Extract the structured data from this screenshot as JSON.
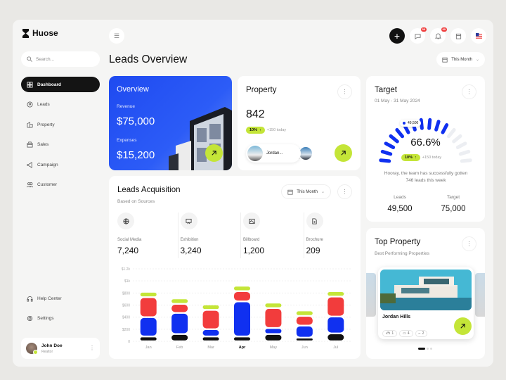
{
  "app": {
    "name": "Huose",
    "search_placeholder": "Search..."
  },
  "sidebar": {
    "items": [
      {
        "label": "Dashboard",
        "icon": "grid-icon",
        "active": true
      },
      {
        "label": "Leads",
        "icon": "leads-icon"
      },
      {
        "label": "Property",
        "icon": "building-icon"
      },
      {
        "label": "Sales",
        "icon": "sales-icon"
      },
      {
        "label": "Campaign",
        "icon": "megaphone-icon"
      },
      {
        "label": "Customer",
        "icon": "users-icon"
      }
    ],
    "bottom": [
      {
        "label": "Help Center",
        "icon": "headset-icon"
      },
      {
        "label": "Settings",
        "icon": "gear-icon"
      }
    ],
    "user": {
      "name": "John Doe",
      "role": "Realtor"
    }
  },
  "header": {
    "messages_badge": "99",
    "notifications_badge": "99",
    "title": "Leads Overview",
    "period": "This Month"
  },
  "overview": {
    "title": "Overview",
    "revenue_label": "Revenue",
    "revenue": "$75,000",
    "expenses_label": "Expenses",
    "expenses": "$15,200"
  },
  "property": {
    "title": "Property",
    "count": "842",
    "change": "10%",
    "today": "+150 today",
    "first_name": "Jordan..."
  },
  "target": {
    "title": "Target",
    "range": "01 May - 31 May 2024",
    "percent": "66.6%",
    "progress": 0.666,
    "marker": "49,500",
    "change": "10%",
    "today": "+150 today",
    "message": "Hooray, the team has successfully gotten 746 leads this week",
    "leads_label": "Leads",
    "leads": "49,500",
    "target_label": "Target",
    "target": "75,000"
  },
  "leads": {
    "title": "Leads Acquisition",
    "subtitle": "Based on Sources",
    "period": "This Month",
    "sources": [
      {
        "label": "Social Media",
        "value": "7,240",
        "icon": "globe-icon"
      },
      {
        "label": "Exhibition",
        "value": "3,240",
        "icon": "presentation-icon"
      },
      {
        "label": "Billboard",
        "value": "1,200",
        "icon": "image-icon"
      },
      {
        "label": "Brochure",
        "value": "209",
        "icon": "document-icon"
      }
    ]
  },
  "chart_data": {
    "type": "bar",
    "stacked": true,
    "categories": [
      "Jan",
      "Feb",
      "Mar",
      "Apr",
      "May",
      "Jun",
      "Jul"
    ],
    "highlight": "Apr",
    "yticks": [
      "0",
      "$200",
      "$400",
      "$600",
      "$800",
      "$1k",
      "$1.2k"
    ],
    "ylim": [
      0,
      1200
    ],
    "grid": true,
    "series": [
      {
        "name": "black",
        "color": "#111111",
        "values": [
          80,
          120,
          80,
          80,
          120,
          60,
          130
        ]
      },
      {
        "name": "blue",
        "color": "#1030f0",
        "values": [
          320,
          350,
          120,
          580,
          100,
          200,
          280
        ]
      },
      {
        "name": "red",
        "color": "#f23c3c",
        "values": [
          330,
          150,
          320,
          170,
          330,
          160,
          330
        ]
      },
      {
        "name": "green",
        "color": "#c4e538",
        "values": [
          90,
          90,
          90,
          90,
          90,
          90,
          90
        ]
      }
    ]
  },
  "top_property": {
    "title": "Top Property",
    "subtitle": "Best Performing Properties",
    "name": "Jordan Hills",
    "cars": "1",
    "beds": "4",
    "baths": "2"
  }
}
